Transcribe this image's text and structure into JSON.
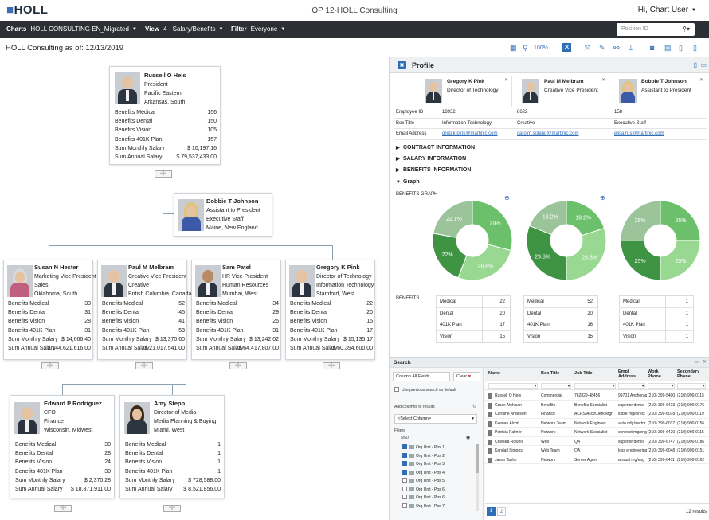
{
  "app": {
    "logo_mark": "■",
    "logo_text": "HOLL",
    "title": "OP 12-HOLL Consulting",
    "user": "Hi, Chart User"
  },
  "toolbar": {
    "charts_label": "Charts",
    "charts_value": "HOLL CONSULTING EN_Migrated",
    "view_label": "View",
    "view_value": "4 - Salary/Benefits",
    "filter_label": "Filter",
    "filter_value": "Everyone",
    "position_placeholder": "Position ID"
  },
  "subheader": {
    "as_of": "HOLL Consulting as of: 12/13/2019",
    "zoom": "100%"
  },
  "metric_labels": [
    "Benefits Medical",
    "Benefits Dental",
    "Benefits Vision",
    "Benefits 401K Plan",
    "Sum Monthly Salary",
    "Sum Annual Salary"
  ],
  "org": {
    "root": {
      "name": "Russell O Heis",
      "info": [
        "President",
        "Pacific Eastern",
        "Arkansas, South"
      ],
      "values": [
        "156",
        "150",
        "105",
        "157",
        "$ 10,197.16",
        "$ 79,537,433.00"
      ]
    },
    "assistant": {
      "name": "Bobbie T Johnson",
      "info": [
        "Assistant to President",
        "Executive Staff",
        "Maine, New England"
      ]
    },
    "level2": [
      {
        "name": "Susan N Hester",
        "info": [
          "Marketing Vice President",
          "Sales",
          "Oklahoma, South"
        ],
        "values": [
          "33",
          "31",
          "28",
          "31",
          "$ 14,666.40",
          "$ 144,621,616.00"
        ]
      },
      {
        "name": "Paul M Melbram",
        "info": [
          "Creative Vice President",
          "Creative",
          "British Columbia, Canada"
        ],
        "values": [
          "52",
          "45",
          "41",
          "53",
          "$ 13,370.60",
          "$ 21,017,541.00"
        ]
      },
      {
        "name": "Sam Patel",
        "info": [
          "HR Vice President",
          "Human Resources",
          "Mumbai, West"
        ],
        "values": [
          "34",
          "29",
          "26",
          "31",
          "$ 13,242.02",
          "$ 64,417,807.00"
        ]
      },
      {
        "name": "Gregory K Pink",
        "info": [
          "Director of Technology",
          "Information Technology",
          "Stamford, West"
        ],
        "values": [
          "22",
          "20",
          "15",
          "17",
          "$ 15,135.17",
          "$ 60,394,600.00"
        ]
      }
    ],
    "level3": [
      {
        "name": "Edward P Rodriguez",
        "info": [
          "CFO",
          "Finance",
          "Wisconsin, Midwest"
        ],
        "values": [
          "30",
          "28",
          "24",
          "30",
          "$ 2,370.28",
          "$ 18,871,911.00"
        ]
      },
      {
        "name": "Amy Stepp",
        "info": [
          "Director of Media",
          "Media Planning & Buying",
          "Miami, West"
        ],
        "values": [
          "1",
          "1",
          "1",
          "1",
          "$ 728,588.00",
          "$ 8,521,856.00"
        ]
      }
    ],
    "expand_label": "−|−"
  },
  "profile": {
    "title": "Profile",
    "people": [
      {
        "name": "Gregory K Pink",
        "title": "Director of Technology"
      },
      {
        "name": "Paul M Melbram",
        "title": "Creative Vice President"
      },
      {
        "name": "Bobbie T Johnson",
        "title": "Assistant to President"
      }
    ],
    "fields": [
      {
        "label": "Employee ID",
        "values": [
          "18932",
          "8622",
          "158"
        ]
      },
      {
        "label": "Box Title",
        "values": [
          "Information Technology",
          "Creative",
          "Executive Staff"
        ]
      },
      {
        "label": "Email Address",
        "values": [
          "greg.k.pink@martinic.com",
          "carolm.soland@martinic.com",
          "elisa.rus@martinic.com"
        ]
      }
    ],
    "sections": [
      "CONTRACT INFORMATION",
      "SALARY INFORMATION",
      "BENEFITS INFORMATION",
      "Graph"
    ],
    "graph_label": "BENEFITS GRAPH",
    "benefits_label": "BENEFITS"
  },
  "chart_data": [
    {
      "type": "pie",
      "title": "",
      "series": [
        {
          "values": [
            29,
            26.8,
            22,
            22.1
          ]
        }
      ]
    },
    {
      "type": "pie",
      "title": "",
      "series": [
        {
          "values": [
            19.2,
            28.8,
            29.8,
            18.2
          ]
        }
      ]
    },
    {
      "type": "pie",
      "title": "",
      "series": [
        {
          "values": [
            25,
            25,
            25,
            25
          ]
        }
      ]
    }
  ],
  "donut_labels": [
    [
      "29%",
      "26.8%",
      "22%",
      "22.1%"
    ],
    [
      "19.2%",
      "28.8%",
      "29.8%",
      "18.2%"
    ],
    [
      "25%",
      "25%",
      "25%",
      "25%"
    ]
  ],
  "donut_colors": [
    "#6cc06c",
    "#98d891",
    "#3f9444",
    "#9bc49b"
  ],
  "benefit_tables": [
    [
      {
        "l": "Medical",
        "v": "22"
      },
      {
        "l": "Dental",
        "v": "20"
      },
      {
        "l": "401K Plan",
        "v": "17"
      },
      {
        "l": "Vision",
        "v": "15"
      }
    ],
    [
      {
        "l": "Medical",
        "v": "52"
      },
      {
        "l": "Dental",
        "v": "20"
      },
      {
        "l": "401K Plan",
        "v": "16"
      },
      {
        "l": "Vision",
        "v": "15"
      }
    ],
    [
      {
        "l": "Medical",
        "v": "1"
      },
      {
        "l": "Dental",
        "v": "1"
      },
      {
        "l": "401K Plan",
        "v": "1"
      },
      {
        "l": "Vision",
        "v": "1"
      }
    ]
  ],
  "search": {
    "title": "Search",
    "column_label": "Column",
    "column_value": "All Fields",
    "clear_label": "Clear",
    "prev_search": "Use previous search as default",
    "add_columns": "Add columns to results",
    "select_column": "<Select Column>",
    "filters_label": "Filters",
    "filter_count": "5/50",
    "org_items": [
      {
        "label": "Org Unit - Pos 1",
        "on": true
      },
      {
        "label": "Org Unit - Pos 2",
        "on": true
      },
      {
        "label": "Org Unit - Pos 3",
        "on": true
      },
      {
        "label": "Org Unit - Pos 4",
        "on": true
      },
      {
        "label": "Org Unit - Pos 5",
        "on": false
      },
      {
        "label": "Org Unit - Pos 6",
        "on": false
      },
      {
        "label": "Org Unit - Pos 6",
        "on": false
      },
      {
        "label": "Org Unit - Pos 7",
        "on": false
      }
    ],
    "grid_headers": [
      "Name",
      "Box Title",
      "Job Title",
      "Empl Address",
      "Work Phone",
      "Secondary Phone"
    ],
    "rows": [
      [
        "Russell O Heis",
        "Commercial",
        "762829-48456",
        "99701 Anchorage",
        "(210) 399-5400",
        "(210) 990-0115"
      ],
      [
        "Grace Atchison",
        "Benefits",
        "Benefits Specialist",
        "superior demo",
        "(210) 399-6423",
        "(210) 990-0176"
      ],
      [
        "Caroline Andeson",
        "Finance",
        "ACRS Acct/Clerk Mgr",
        "losse mg/direct",
        "(210) 399-6078",
        "(210) 990-0119"
      ],
      [
        "Keenan Alcott",
        "Network Team",
        "Network Engineer",
        "auto mfg/sector",
        "(210) 399-6017",
        "(210) 990-0156"
      ],
      [
        "Patricia Palmer",
        "Network",
        "Network Specialist",
        "contract mg/eng",
        "(210) 399-6420",
        "(210) 990-0115"
      ],
      [
        "Chelsea Rowell",
        "Web",
        "QA",
        "superior demo",
        "(210) 399-6747",
        "(210) 990-0186"
      ],
      [
        "Kendall Simons",
        "Web Team",
        "QA",
        "loss engineering",
        "(210) 399-6048",
        "(210) 990-0151"
      ],
      [
        "Jason Taylor",
        "Network",
        "Server Agent",
        "annual mg/eng",
        "(210) 399-6411",
        "(210) 990-0162"
      ]
    ],
    "pages": [
      "1",
      "2"
    ],
    "results": "12 results"
  }
}
